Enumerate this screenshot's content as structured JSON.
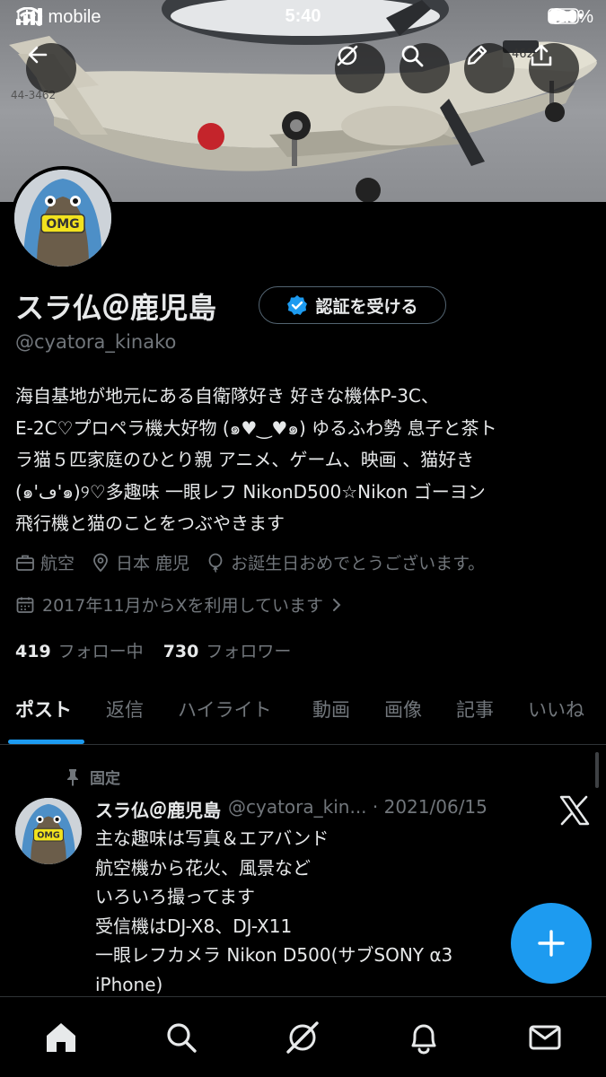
{
  "status_bar": {
    "carrier": "UQ mobile",
    "time": "5:40",
    "battery": "100%"
  },
  "banner": {
    "aircraft_marking": "462",
    "tail_marking": "44-3462"
  },
  "profile": {
    "display_name": "スラ仏＠鹿児島",
    "handle": "@cyatora_kinako",
    "verify_button": "認証を受ける",
    "bio_lines": [
      "海自基地が地元にある自衛隊好き 好きな機体P-3C、",
      "E-2C♡プロペラ機大好物 (๑♥︎‿♥︎๑) ゆるふわ勢 息子と茶ト",
      "ラ猫５匹家庭のひとり親 アニメ、ゲーム、映画 、猫好き",
      "(๑'ڡ'๑)୨♡多趣味 一眼レフ NikonD500☆Nikon ゴーヨン",
      "飛行機と猫のことをつぶやきます"
    ],
    "category": "航空",
    "location": "日本 鹿児",
    "birthday": "お誕生日おめでとうございます。",
    "joined": "2017年11月からXを利用しています",
    "following_count": "419",
    "following_label": "フォロー中",
    "followers_count": "730",
    "followers_label": "フォロワー",
    "avatar_badge": "OMG"
  },
  "tabs": [
    "ポスト",
    "返信",
    "ハイライト",
    "動画",
    "画像",
    "記事",
    "いいね"
  ],
  "pinned_tweet": {
    "pinned_label": "固定",
    "name": "スラ仏＠鹿児島",
    "handle_date": "@cyatora_kin... · 2021/06/15",
    "lines": [
      "主な趣味は写真＆エアバンド",
      "航空機から花火、風景など",
      "いろいろ撮ってます",
      "受信機はDJ-X8、DJ-X11",
      "一眼レフカメラ Nikon D500(サブSONY α3",
      "iPhone)"
    ]
  },
  "colors": {
    "accent": "#1d9bf0",
    "text_primary": "#e7e9ea",
    "text_secondary": "#71767b",
    "border": "#2f3336"
  },
  "icons": {
    "back": "arrow-left-icon",
    "grok": "grok-icon",
    "search": "search-icon",
    "edit": "pencil-icon",
    "share": "share-icon",
    "verified": "verified-badge-icon",
    "home": "home-icon",
    "notifications": "bell-icon",
    "messages": "envelope-icon",
    "compose": "plus-icon"
  }
}
